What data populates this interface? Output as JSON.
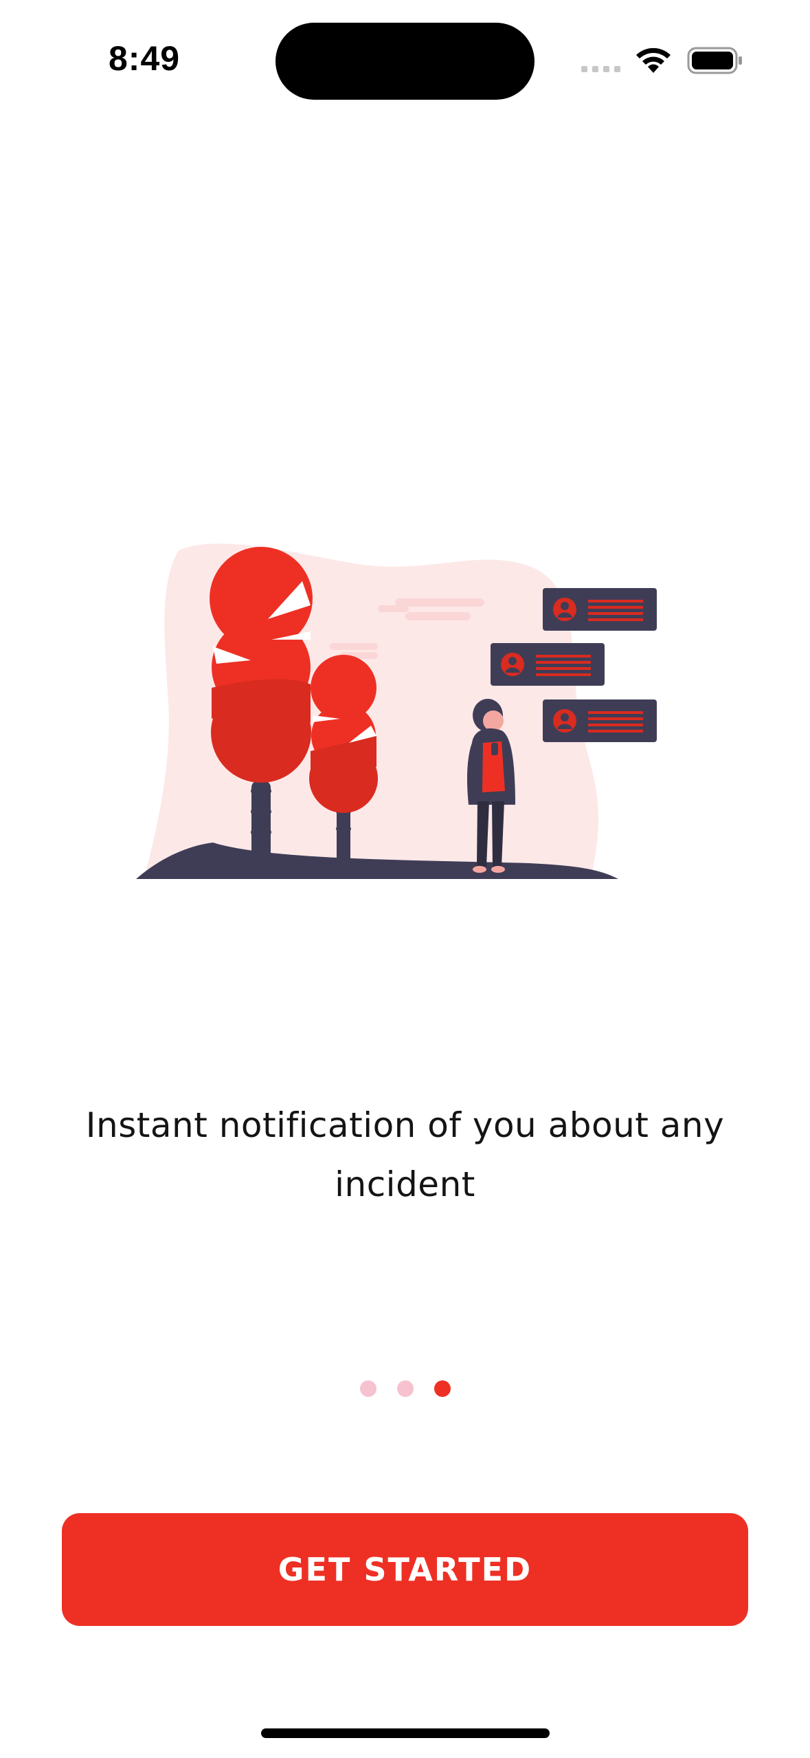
{
  "status_bar": {
    "time": "8:49",
    "icons": [
      "signal-icon",
      "wifi-icon",
      "battery-icon"
    ]
  },
  "onboarding": {
    "illustration": "notification-illustration",
    "message": "Instant notification of you about any incident",
    "page_count": 3,
    "active_page": 3,
    "cta_label": "GET STARTED"
  },
  "colors": {
    "accent": "#ee3024",
    "dot_inactive": "#f6c2cf",
    "blob": "#fde8e8",
    "dark": "#3f3d56"
  }
}
